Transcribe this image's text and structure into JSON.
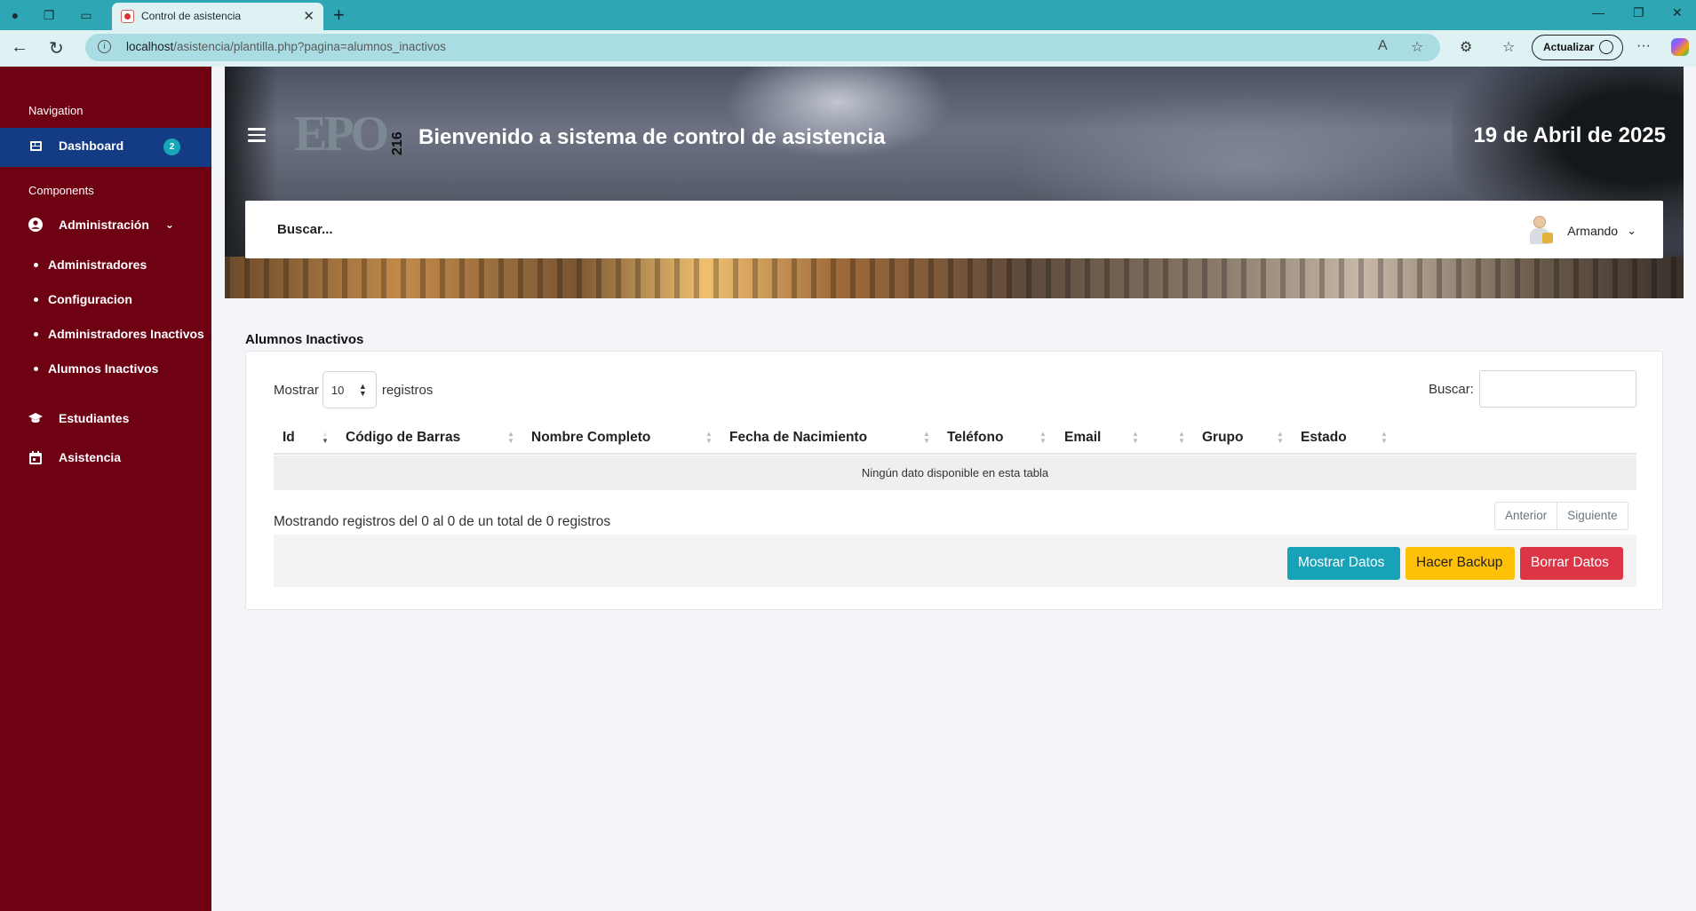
{
  "browser": {
    "tab_title": "Control de asistencia",
    "url_host": "localhost",
    "url_path": "/asistencia/plantilla.php?pagina=alumnos_inactivos",
    "update_label": "Actualizar"
  },
  "sidebar": {
    "section_navigation": "Navigation",
    "dashboard": {
      "label": "Dashboard",
      "badge": "2"
    },
    "section_components": "Components",
    "administracion": {
      "label": "Administración"
    },
    "sub_items": [
      {
        "label": "Administradores"
      },
      {
        "label": "Configuracion"
      },
      {
        "label": "Administradores Inactivos"
      },
      {
        "label": "Alumnos Inactivos"
      }
    ],
    "estudiantes": {
      "label": "Estudiantes"
    },
    "asistencia": {
      "label": "Asistencia"
    }
  },
  "header": {
    "logo_text": "EPO",
    "logo_number": "216",
    "welcome": "Bienvenido a sistema de control de asistencia",
    "date": "19 de Abril de 2025",
    "search_placeholder": "Buscar...",
    "user_name": "Armando"
  },
  "main": {
    "title": "Alumnos Inactivos",
    "length_prefix": "Mostrar",
    "length_value": "10",
    "length_suffix": "registros",
    "search_label": "Buscar:",
    "columns": [
      "Id",
      "Código de Barras",
      "Nombre Completo",
      "Fecha de Nacimiento",
      "Teléfono",
      "Email",
      "Grupo",
      "Estado"
    ],
    "empty_message": "Ningún dato disponible en esta tabla",
    "info": "Mostrando registros del 0 al 0 de un total de 0 registros",
    "pager": {
      "prev": "Anterior",
      "next": "Siguiente"
    },
    "buttons": {
      "show": "Mostrar Datos",
      "backup": "Hacer Backup",
      "delete": "Borrar Datos"
    }
  },
  "colors": {
    "sidebar_bg": "#6e0112",
    "sidebar_active": "#133c84",
    "browser_accent": "#2fa6b3",
    "btn_info": "#17a2b8",
    "btn_warning": "#ffc107",
    "btn_danger": "#dc3545"
  }
}
